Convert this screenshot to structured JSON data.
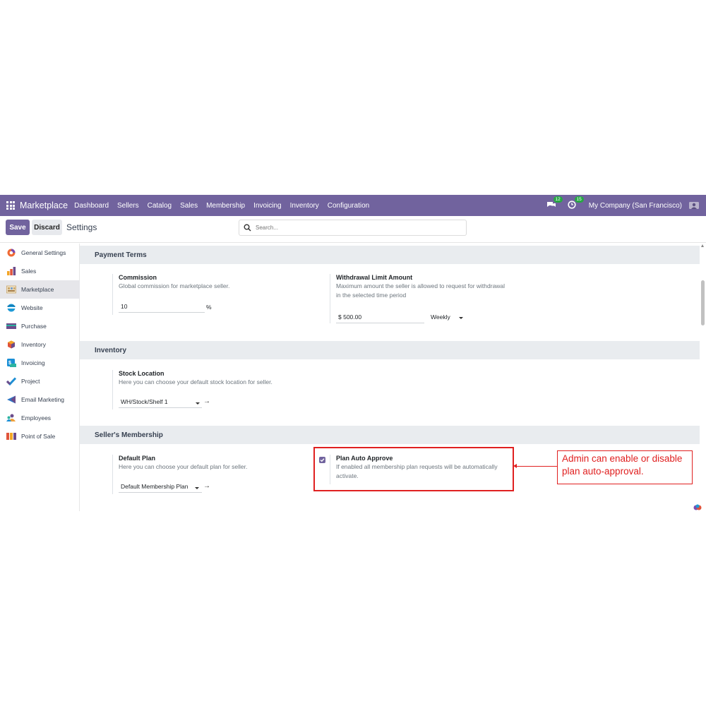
{
  "app": {
    "name": "Marketplace",
    "menu": [
      "Dashboard",
      "Sellers",
      "Catalog",
      "Sales",
      "Membership",
      "Invoicing",
      "Inventory",
      "Configuration"
    ],
    "messages_count": "12",
    "activities_count": "15",
    "company": "My Company (San Francisco)"
  },
  "control_panel": {
    "save_label": "Save",
    "discard_label": "Discard",
    "title": "Settings",
    "search_placeholder": "Search..."
  },
  "sidebar": {
    "items": [
      {
        "label": "General Settings",
        "icon": "general-settings-icon",
        "color": "#f06a35"
      },
      {
        "label": "Sales",
        "icon": "sales-icon",
        "color": "#f3a626"
      },
      {
        "label": "Marketplace",
        "icon": "marketplace-icon",
        "color": "#c9a66b",
        "active": true
      },
      {
        "label": "Website",
        "icon": "website-icon",
        "color": "#1e9ad6"
      },
      {
        "label": "Purchase",
        "icon": "purchase-icon",
        "color": "#6c4c8b"
      },
      {
        "label": "Inventory",
        "icon": "inventory-icon",
        "color": "#e0533b"
      },
      {
        "label": "Invoicing",
        "icon": "invoicing-icon",
        "color": "#1b8fd6"
      },
      {
        "label": "Project",
        "icon": "project-icon",
        "color": "#1f8fd4"
      },
      {
        "label": "Email Marketing",
        "icon": "email-marketing-icon",
        "color": "#2e77c7"
      },
      {
        "label": "Employees",
        "icon": "employees-icon",
        "color": "#f0a13c"
      },
      {
        "label": "Point of Sale",
        "icon": "point-of-sale-icon",
        "color": "#e0543b"
      }
    ]
  },
  "sections": {
    "payment_terms": {
      "title": "Payment Terms",
      "commission": {
        "label": "Commission",
        "desc": "Global commission for marketplace seller.",
        "value": "10",
        "unit": "%"
      },
      "withdrawal": {
        "label": "Withdrawal Limit Amount",
        "desc_line1": "Maximum amount the seller is allowed to request for withdrawal",
        "desc_line2": "in the selected time period",
        "amount": "$ 500.00",
        "period": "Weekly"
      }
    },
    "inventory": {
      "title": "Inventory",
      "stock_location": {
        "label": "Stock Location",
        "desc": "Here you can choose your default stock location for seller.",
        "value": "WH/Stock/Shelf 1"
      }
    },
    "membership": {
      "title": "Seller's Membership",
      "default_plan": {
        "label": "Default Plan",
        "desc": "Here you can choose your default plan for seller.",
        "value": "Default Membership Plan"
      },
      "auto_approve": {
        "label": "Plan Auto Approve",
        "desc_line1": "If enabled all membership plan requests will be automatically",
        "desc_line2": "activate.",
        "checked": true
      }
    }
  },
  "annotation": {
    "text": "Admin can enable or disable plan auto-approval.",
    "color": "#e02020"
  },
  "colors": {
    "brand": "#71639e",
    "section_bg": "#e9ecef",
    "badge": "#28a745"
  }
}
